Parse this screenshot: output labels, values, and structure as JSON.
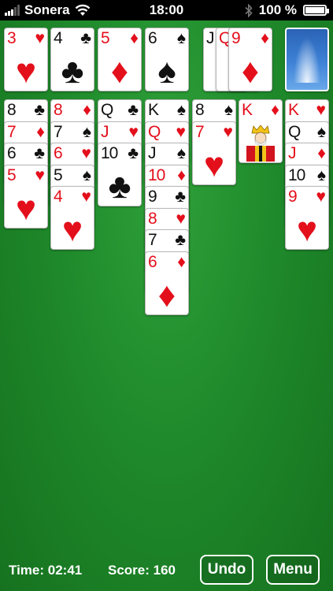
{
  "status_bar": {
    "carrier": "Sonera",
    "time": "18:00",
    "battery": "100 %"
  },
  "colors": {
    "felt": "#1f8a2b",
    "red_suit": "#e30f1b",
    "black_suit": "#111111"
  },
  "foundations": [
    {
      "rank": "3",
      "suit": "♥",
      "color": "red"
    },
    {
      "rank": "4",
      "suit": "♣",
      "color": "black"
    },
    {
      "rank": "5",
      "suit": "♦",
      "color": "red"
    },
    {
      "rank": "6",
      "suit": "♠",
      "color": "black"
    }
  ],
  "waste": [
    {
      "rank": "J",
      "suit": "",
      "color": "black"
    },
    {
      "rank": "Q",
      "suit": "",
      "color": "red"
    },
    {
      "rank": "9",
      "suit": "♦",
      "color": "red"
    }
  ],
  "stock": {
    "icon": "card-back-icon"
  },
  "tableau": [
    [
      {
        "rank": "8",
        "suit": "♣",
        "color": "black"
      },
      {
        "rank": "7",
        "suit": "♦",
        "color": "red"
      },
      {
        "rank": "6",
        "suit": "♣",
        "color": "black"
      },
      {
        "rank": "5",
        "suit": "♥",
        "color": "red"
      }
    ],
    [
      {
        "rank": "8",
        "suit": "♦",
        "color": "red"
      },
      {
        "rank": "7",
        "suit": "♠",
        "color": "black"
      },
      {
        "rank": "6",
        "suit": "♥",
        "color": "red"
      },
      {
        "rank": "5",
        "suit": "♠",
        "color": "black"
      },
      {
        "rank": "4",
        "suit": "♥",
        "color": "red"
      }
    ],
    [
      {
        "rank": "Q",
        "suit": "♣",
        "color": "black"
      },
      {
        "rank": "J",
        "suit": "♥",
        "color": "red"
      },
      {
        "rank": "10",
        "suit": "♣",
        "color": "black"
      }
    ],
    [
      {
        "rank": "K",
        "suit": "♠",
        "color": "black"
      },
      {
        "rank": "Q",
        "suit": "♥",
        "color": "red"
      },
      {
        "rank": "J",
        "suit": "♠",
        "color": "black"
      },
      {
        "rank": "10",
        "suit": "♦",
        "color": "red"
      },
      {
        "rank": "9",
        "suit": "♣",
        "color": "black"
      },
      {
        "rank": "8",
        "suit": "♥",
        "color": "red"
      },
      {
        "rank": "7",
        "suit": "♣",
        "color": "black"
      },
      {
        "rank": "6",
        "suit": "♦",
        "color": "red"
      }
    ],
    [
      {
        "rank": "8",
        "suit": "♠",
        "color": "black"
      },
      {
        "rank": "7",
        "suit": "♥",
        "color": "red"
      }
    ],
    [
      {
        "rank": "K",
        "suit": "♦",
        "color": "red"
      }
    ],
    [
      {
        "rank": "K",
        "suit": "♥",
        "color": "red"
      },
      {
        "rank": "Q",
        "suit": "♠",
        "color": "black"
      },
      {
        "rank": "J",
        "suit": "♦",
        "color": "red"
      },
      {
        "rank": "10",
        "suit": "♠",
        "color": "black"
      },
      {
        "rank": "9",
        "suit": "♥",
        "color": "red"
      }
    ]
  ],
  "footer": {
    "time_text": "Time: 02:41",
    "score_text": "Score: 160",
    "undo_label": "Undo",
    "menu_label": "Menu"
  }
}
